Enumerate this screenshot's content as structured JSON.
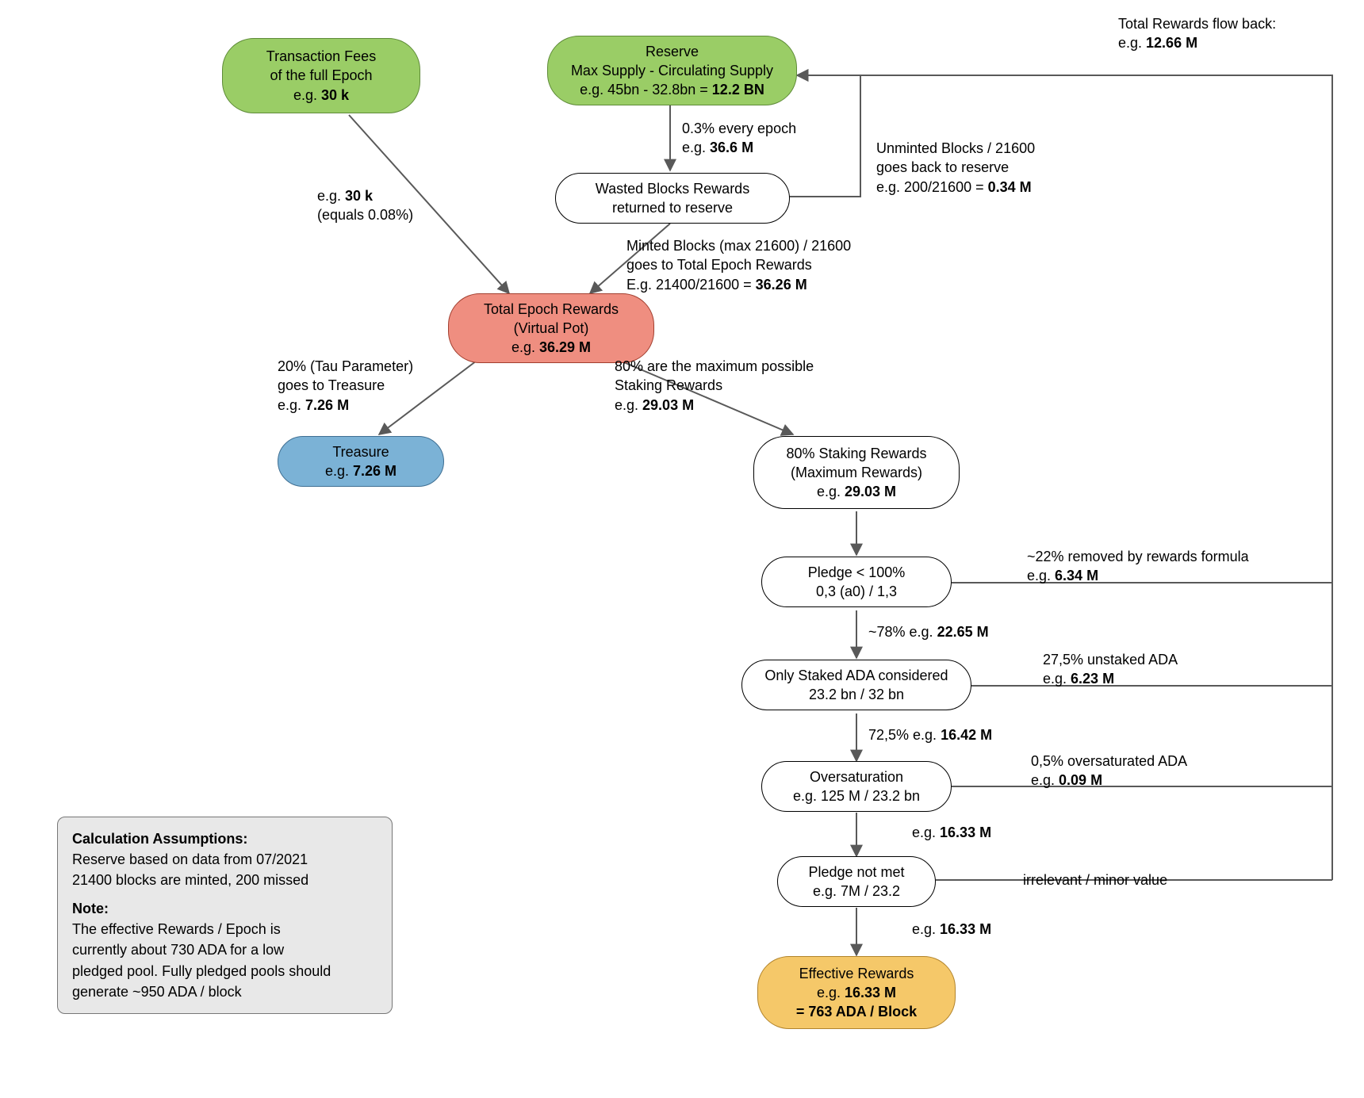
{
  "nodes": {
    "txfees": {
      "line1": "Transaction Fees",
      "line2": "of the full Epoch",
      "line3": "e.g. ",
      "val": "30 k"
    },
    "reserve": {
      "line1": "Reserve",
      "line2": "Max Supply - Circulating Supply",
      "line3": "e.g. 45bn - 32.8bn = ",
      "val": "12.2 BN"
    },
    "wasted": {
      "line1": "Wasted Blocks Rewards",
      "line2": "returned to reserve"
    },
    "pot": {
      "line1": "Total Epoch Rewards",
      "line2": "(Virtual Pot)",
      "line3": "e.g. ",
      "val": "36.29 M"
    },
    "treasure": {
      "line1": "Treasure",
      "line2": "e.g. ",
      "val": "7.26 M"
    },
    "staking": {
      "line1": "80% Staking Rewards",
      "line2": "(Maximum Rewards)",
      "line3": "e.g. ",
      "val": "29.03 M"
    },
    "pledge100": {
      "line1": "Pledge < 100%",
      "line2": "0,3 (a0) / 1,3"
    },
    "staked": {
      "line1": "Only Staked ADA considered",
      "line2": "23.2 bn / 32 bn"
    },
    "oversat": {
      "line1": "Oversaturation",
      "line2": "e.g. 125 M / 23.2 bn"
    },
    "pledgenot": {
      "line1": "Pledge not met",
      "line2": "e.g. 7M / 23.2"
    },
    "effective": {
      "line1": "Effective Rewards",
      "line2": "e.g. ",
      "val2": "16.33 M",
      "line3": "= 763 ADA / Block"
    }
  },
  "edges": {
    "flowback": {
      "line1": "Total Rewards flow back:",
      "line2": "e.g. ",
      "val": "12.66 M"
    },
    "from_reserve": {
      "line1": "0.3% every epoch",
      "line2": "e.g. ",
      "val": "36.6 M"
    },
    "unminted": {
      "line1": "Unminted Blocks / 21600",
      "line2": "goes back to reserve",
      "line3": "e.g. 200/21600 = ",
      "val": "0.34 M"
    },
    "minted": {
      "line1": "Minted Blocks (max 21600) / 21600",
      "line2": "goes to Total Epoch Rewards",
      "line3": "E.g. 21400/21600 = ",
      "val": "36.26 M"
    },
    "txfees_in": {
      "line1": "e.g. ",
      "val": "30 k",
      "line2": "(equals 0.08%)"
    },
    "tau": {
      "line1": "20% (Tau Parameter)",
      "line2": "goes to Treasure",
      "line3": "e.g. ",
      "val": "7.26 M"
    },
    "eighty": {
      "line1": "80% are the maximum possible",
      "line2": "Staking Rewards",
      "line3": "e.g. ",
      "val": "29.03 M"
    },
    "remove22": {
      "line1": "~22% removed by rewards formula",
      "line2": "e.g. ",
      "val": "6.34 M"
    },
    "seventyeight": {
      "line1": "~78% e.g. ",
      "val": "22.65 M"
    },
    "unstaked": {
      "line1": "27,5% unstaked ADA",
      "line2": "e.g. ",
      "val": "6.23 M"
    },
    "seventytwo": {
      "line1": "72,5% e.g. ",
      "val": "16.42 M"
    },
    "oversat_out": {
      "line1": "0,5% oversaturated ADA",
      "line2": "e.g. ",
      "val": "0.09 M"
    },
    "after_oversat": {
      "line1": "e.g. ",
      "val": "16.33 M"
    },
    "irrelevant": {
      "line1": "irrelevant / minor value"
    },
    "after_pledge": {
      "line1": "e.g. ",
      "val": "16.33 M"
    }
  },
  "note": {
    "h1": "Calculation Assumptions:",
    "l1": "Reserve based on data from 07/2021",
    "l2": "21400 blocks are minted, 200 missed",
    "h2": "Note:",
    "l3": "The effective Rewards / Epoch is",
    "l4": "currently about 730 ADA for a low",
    "l5": "pledged pool. Fully pledged pools should",
    "l6": "generate ~950 ADA / block"
  },
  "colors": {
    "green": "#9acd66",
    "red": "#ef8e80",
    "blue": "#7bb2d6",
    "orange": "#f5c869",
    "grey": "#e8e8e8"
  }
}
